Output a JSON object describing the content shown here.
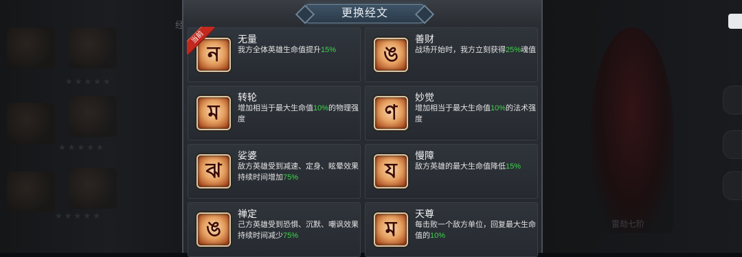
{
  "dialog": {
    "title": "更换经文"
  },
  "background": {
    "left_tab": "经",
    "right_hero_name": "雷劫七阶"
  },
  "badge": {
    "current": "当前"
  },
  "scriptures": [
    {
      "name": "无量",
      "glyph": "ন",
      "desc_pre": "我方全体英雄生命值提升",
      "desc_hl": "15%",
      "desc_post": ""
    },
    {
      "name": "善财",
      "glyph": "ঙ",
      "desc_pre": "战场开始时，我方立刻获得",
      "desc_hl": "25%",
      "desc_post": "魂值"
    },
    {
      "name": "转轮",
      "glyph": "ম",
      "desc_pre": "增加相当于最大生命值",
      "desc_hl": "10%",
      "desc_post": "的物理强度"
    },
    {
      "name": "妙觉",
      "glyph": "ণ",
      "desc_pre": "增加相当于最大生命值",
      "desc_hl": "10%",
      "desc_post": "的法术强度"
    },
    {
      "name": "娑婆",
      "glyph": "ঝ",
      "desc_pre": "敌方英雄受到减速、定身、眩晕效果持续时间增加",
      "desc_hl": "75%",
      "desc_post": ""
    },
    {
      "name": "慢障",
      "glyph": "য",
      "desc_pre": "敌方英雄的最大生命值降低",
      "desc_hl": "15%",
      "desc_post": ""
    },
    {
      "name": "禅定",
      "glyph": "ঙ",
      "desc_pre": "己方英雄受到恐惧、沉默、嘲讽效果持续时间减少",
      "desc_hl": "75%",
      "desc_post": ""
    },
    {
      "name": "天尊",
      "glyph": "ম",
      "desc_pre": "每击败一个敌方单位，回复最大生命值的",
      "desc_hl": "10%",
      "desc_post": ""
    }
  ]
}
